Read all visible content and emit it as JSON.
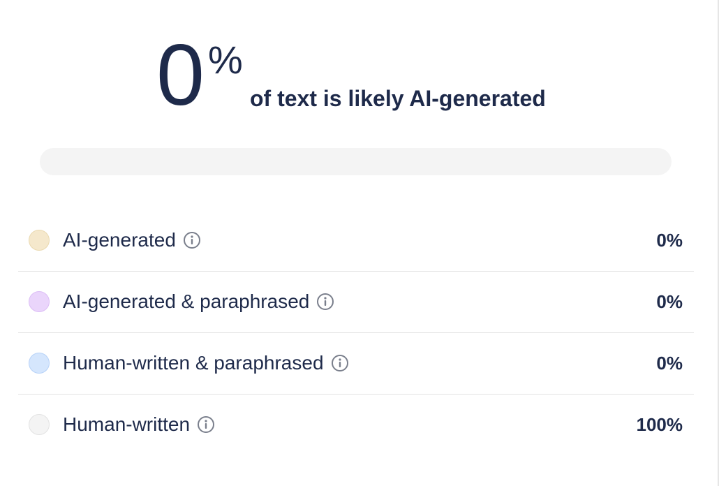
{
  "summary": {
    "percent_value": "0",
    "percent_sign": "%",
    "caption": "of text is likely AI-generated"
  },
  "progress": {
    "ai_fraction": 0.0,
    "fill_color": "#f5e6c8",
    "track_color": "#f4f4f4"
  },
  "legend": {
    "items": [
      {
        "label": "AI-generated",
        "value": "0%",
        "swatch_color": "#f5e8cc",
        "swatch_border": "#ead9b0",
        "icon": "info-icon"
      },
      {
        "label": "AI-generated & paraphrased",
        "value": "0%",
        "swatch_color": "#ead5fb",
        "swatch_border": "#dcbdf6",
        "icon": "info-icon"
      },
      {
        "label": "Human-written & paraphrased",
        "value": "0%",
        "swatch_color": "#d5e6fd",
        "swatch_border": "#b7d2f8",
        "icon": "info-icon"
      },
      {
        "label": "Human-written",
        "value": "100%",
        "swatch_color": "#f4f4f4",
        "swatch_border": "#e2e2e2",
        "icon": "info-icon"
      }
    ]
  }
}
